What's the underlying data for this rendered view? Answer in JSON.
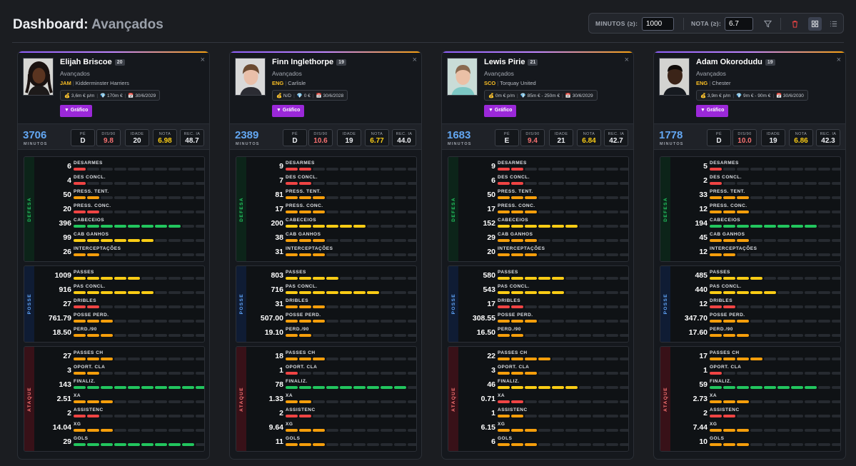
{
  "header": {
    "title": "Dashboard:",
    "subtitle": "Avançados"
  },
  "filters": {
    "minutes_label": "MINUTOS (≥):",
    "minutes_value": "1000",
    "rating_label": "NOTA (≥):",
    "rating_value": "6.7"
  },
  "icons": {
    "filter": "filter-icon",
    "trash": "trash-icon",
    "grid": "grid-view-icon",
    "list": "list-view-icon",
    "close": "close-icon"
  },
  "colors": {
    "red": "#ef4444",
    "orange": "#f59e0b",
    "yellow": "#facc15",
    "green": "#22c55e",
    "minutes": "#63a7f2",
    "graph_button": "#9b28d9"
  },
  "labels": {
    "graph": "▼ Gráfico",
    "close": "×",
    "minutes": "MINUTOS",
    "pe": "PÉ",
    "dis90": "DIS/90",
    "idade": "IDADE",
    "nota": "NOTA",
    "rec": "REC. IA",
    "defense": "DEFESA",
    "possession": "POSSE",
    "attack": "ATAQUE",
    "defense_stats": [
      "DESARMES",
      "DES CONCL.",
      "PRESS. TENT.",
      "PRESS. CONC.",
      "CABECEIOS",
      "CAB GANHOS",
      "INTERCEPTAÇÕES"
    ],
    "possession_stats": [
      "PASSES",
      "PAS CONCL.",
      "DRIBLES",
      "POSSE PERD.",
      "PERD./90"
    ],
    "attack_stats": [
      "PASSES CH",
      "OPORT. CLA",
      "FINALIZ.",
      "XA",
      "ASSISTENC",
      "XG",
      "GOLS"
    ]
  },
  "players": [
    {
      "name": "Elijah Briscoe",
      "age": "20",
      "position": "Avançados",
      "nation": "JAM",
      "club": "Kidderminster Harriers",
      "wage": "💰 3,6m € p/m",
      "value": "💎 170m €",
      "contract": "📅 30/6/2029",
      "minutes": "3706",
      "foot": "D",
      "dis90": "9.8",
      "idade": "20",
      "nota": "6.98",
      "rec": "48.7",
      "defense": [
        {
          "v": "6",
          "f": 1,
          "c": "red"
        },
        {
          "v": "4",
          "f": 1,
          "c": "red"
        },
        {
          "v": "50",
          "f": 2,
          "c": "orange"
        },
        {
          "v": "20",
          "f": 2,
          "c": "red"
        },
        {
          "v": "396",
          "f": 8,
          "c": "green"
        },
        {
          "v": "99",
          "f": 6,
          "c": "yellow"
        },
        {
          "v": "26",
          "f": 2,
          "c": "orange"
        }
      ],
      "possession": [
        {
          "v": "1009",
          "f": 5,
          "c": "yellow"
        },
        {
          "v": "916",
          "f": 6,
          "c": "yellow"
        },
        {
          "v": "27",
          "f": 2,
          "c": "red"
        },
        {
          "v": "761.79",
          "f": 3,
          "c": "orange"
        },
        {
          "v": "18.50",
          "f": 3,
          "c": "orange"
        }
      ],
      "attack": [
        {
          "v": "27",
          "f": 3,
          "c": "orange"
        },
        {
          "v": "3",
          "f": 2,
          "c": "orange"
        },
        {
          "v": "143",
          "f": 10,
          "c": "green"
        },
        {
          "v": "2.51",
          "f": 3,
          "c": "orange"
        },
        {
          "v": "2",
          "f": 2,
          "c": "red"
        },
        {
          "v": "14.04",
          "f": 3,
          "c": "orange"
        },
        {
          "v": "29",
          "f": 9,
          "c": "green"
        }
      ]
    },
    {
      "name": "Finn Inglethorpe",
      "age": "19",
      "position": "Avançados",
      "nation": "ENG",
      "club": "Carlisle",
      "wage": "💰 N/D",
      "value": "💎 0 €",
      "contract": "📅 30/6/2028",
      "minutes": "2389",
      "foot": "D",
      "dis90": "10.6",
      "idade": "19",
      "nota": "6.77",
      "rec": "44.0",
      "defense": [
        {
          "v": "9",
          "f": 2,
          "c": "red"
        },
        {
          "v": "7",
          "f": 2,
          "c": "red"
        },
        {
          "v": "81",
          "f": 3,
          "c": "orange"
        },
        {
          "v": "17",
          "f": 3,
          "c": "orange"
        },
        {
          "v": "200",
          "f": 6,
          "c": "yellow"
        },
        {
          "v": "38",
          "f": 3,
          "c": "orange"
        },
        {
          "v": "31",
          "f": 3,
          "c": "orange"
        }
      ],
      "possession": [
        {
          "v": "803",
          "f": 4,
          "c": "yellow"
        },
        {
          "v": "716",
          "f": 7,
          "c": "yellow"
        },
        {
          "v": "31",
          "f": 3,
          "c": "orange"
        },
        {
          "v": "507.00",
          "f": 3,
          "c": "orange"
        },
        {
          "v": "19.10",
          "f": 2,
          "c": "orange"
        }
      ],
      "attack": [
        {
          "v": "18",
          "f": 3,
          "c": "orange"
        },
        {
          "v": "1",
          "f": 1,
          "c": "red"
        },
        {
          "v": "78",
          "f": 9,
          "c": "green"
        },
        {
          "v": "1.33",
          "f": 2,
          "c": "orange"
        },
        {
          "v": "2",
          "f": 2,
          "c": "red"
        },
        {
          "v": "9.64",
          "f": 3,
          "c": "orange"
        },
        {
          "v": "11",
          "f": 3,
          "c": "orange"
        }
      ]
    },
    {
      "name": "Lewis Pirie",
      "age": "21",
      "position": "Avançados",
      "nation": "SCO",
      "club": "Torquay United",
      "wage": "💰 0m € p/m",
      "value": "💎 85m € - 250m €",
      "contract": "📅 30/6/2029",
      "minutes": "1683",
      "foot": "E",
      "dis90": "9.4",
      "idade": "21",
      "nota": "6.84",
      "rec": "42.7",
      "defense": [
        {
          "v": "9",
          "f": 2,
          "c": "red"
        },
        {
          "v": "6",
          "f": 2,
          "c": "red"
        },
        {
          "v": "50",
          "f": 3,
          "c": "orange"
        },
        {
          "v": "17",
          "f": 3,
          "c": "orange"
        },
        {
          "v": "152",
          "f": 6,
          "c": "yellow"
        },
        {
          "v": "29",
          "f": 3,
          "c": "orange"
        },
        {
          "v": "20",
          "f": 3,
          "c": "orange"
        }
      ],
      "possession": [
        {
          "v": "580",
          "f": 5,
          "c": "yellow"
        },
        {
          "v": "543",
          "f": 5,
          "c": "yellow"
        },
        {
          "v": "17",
          "f": 2,
          "c": "red"
        },
        {
          "v": "308.55",
          "f": 3,
          "c": "orange"
        },
        {
          "v": "16.50",
          "f": 2,
          "c": "orange"
        }
      ],
      "attack": [
        {
          "v": "22",
          "f": 4,
          "c": "orange"
        },
        {
          "v": "3",
          "f": 3,
          "c": "orange"
        },
        {
          "v": "46",
          "f": 6,
          "c": "yellow"
        },
        {
          "v": "0.71",
          "f": 2,
          "c": "red"
        },
        {
          "v": "1",
          "f": 2,
          "c": "orange"
        },
        {
          "v": "6.15",
          "f": 3,
          "c": "orange"
        },
        {
          "v": "6",
          "f": 3,
          "c": "orange"
        }
      ]
    },
    {
      "name": "Adam Okorodudu",
      "age": "19",
      "position": "Avançados",
      "nation": "ENG",
      "club": "Chester",
      "wage": "💰 3,9m € p/m",
      "value": "💎 9m € - 90m €",
      "contract": "📅 30/6/2030",
      "minutes": "1778",
      "foot": "D",
      "dis90": "10.0",
      "idade": "19",
      "nota": "6.86",
      "rec": "42.3",
      "defense": [
        {
          "v": "5",
          "f": 1,
          "c": "red"
        },
        {
          "v": "2",
          "f": 1,
          "c": "red"
        },
        {
          "v": "33",
          "f": 3,
          "c": "orange"
        },
        {
          "v": "12",
          "f": 3,
          "c": "orange"
        },
        {
          "v": "194",
          "f": 8,
          "c": "green"
        },
        {
          "v": "45",
          "f": 3,
          "c": "orange"
        },
        {
          "v": "12",
          "f": 2,
          "c": "orange"
        }
      ],
      "possession": [
        {
          "v": "485",
          "f": 4,
          "c": "yellow"
        },
        {
          "v": "440",
          "f": 5,
          "c": "yellow"
        },
        {
          "v": "12",
          "f": 2,
          "c": "red"
        },
        {
          "v": "347.70",
          "f": 3,
          "c": "orange"
        },
        {
          "v": "17.60",
          "f": 3,
          "c": "orange"
        }
      ],
      "attack": [
        {
          "v": "17",
          "f": 4,
          "c": "orange"
        },
        {
          "v": "1",
          "f": 1,
          "c": "red"
        },
        {
          "v": "59",
          "f": 8,
          "c": "green"
        },
        {
          "v": "2.73",
          "f": 3,
          "c": "orange"
        },
        {
          "v": "2",
          "f": 2,
          "c": "red"
        },
        {
          "v": "7.44",
          "f": 3,
          "c": "orange"
        },
        {
          "v": "10",
          "f": 3,
          "c": "orange"
        }
      ]
    }
  ]
}
